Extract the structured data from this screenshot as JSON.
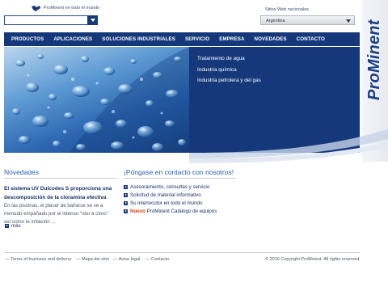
{
  "brand": {
    "logo_text": "ProMinent",
    "globe_text": "ProMinent en todo el mundo",
    "blue": "#14387a",
    "accent": "#d5401b"
  },
  "search": {
    "value": "",
    "placeholder": "",
    "button_icon": "chevron-down-icon"
  },
  "country": {
    "label": "Sitios Web nacionales",
    "selected": "Argentina"
  },
  "nav": {
    "items": [
      "PRODUCTOS",
      "APLICACIONES",
      "SOLUCIONES INDUSTRIALES",
      "SERVICIO",
      "EMPRESA",
      "NOVEDADES",
      "CONTACTO"
    ]
  },
  "hero": {
    "links": [
      "Tratamiento de agua",
      "Industria química",
      "Industria petrolera y del gas"
    ]
  },
  "news": {
    "title": "Novedades",
    "headline": "El sistema UV Dulcodes S proporciona una descomposición de la cloramina efectiva",
    "body": "En las piscinas, el placer de bañarse se ve a menudo empañado por el intenso \"olor a cloro\" así como la irritación ...",
    "more": "más"
  },
  "contact": {
    "title": "¡Póngase en contacto con nosotros!",
    "items": [
      "Asesoramiento, consultas y servicio",
      "Solicitud de material informativo",
      "Su interlocutor en todo el mundo"
    ],
    "new_label": "Nuevo",
    "new_text": "ProMinent Catálogo de equipos"
  },
  "footer": {
    "links": [
      "Terms of business and delivery",
      "Mapa del sitio",
      "Aviso legal",
      "Contacto"
    ],
    "copyright": "© 2016 Copyright ProMinent. All rights reserved."
  }
}
